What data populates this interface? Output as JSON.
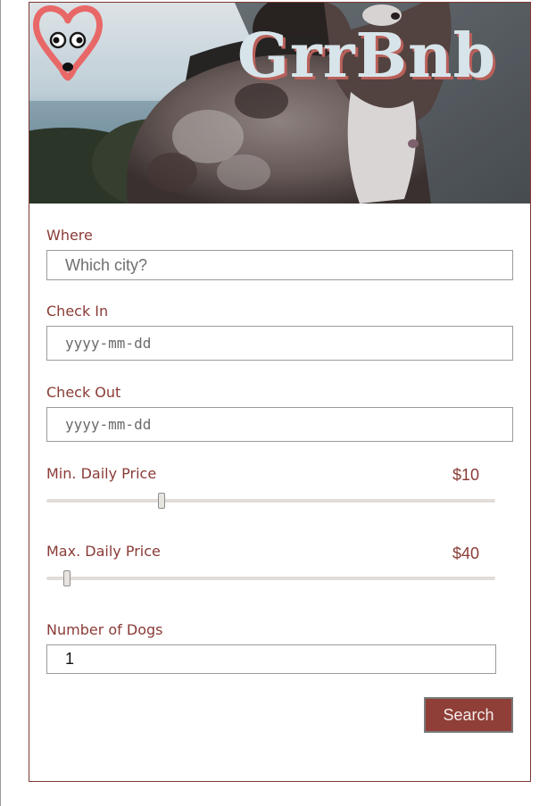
{
  "brand": {
    "name": "GrrBnb",
    "logo_icon": "dog-heart-logo-icon",
    "accent": "#8f3f38",
    "title_color": "#d7e4ea",
    "hero_image": "dog-hero-photo"
  },
  "form": {
    "where": {
      "label": "Where",
      "placeholder": "Which city?",
      "value": ""
    },
    "check_in": {
      "label": "Check In",
      "placeholder": "yyyy-mm-dd",
      "value": ""
    },
    "check_out": {
      "label": "Check Out",
      "placeholder": "yyyy-mm-dd",
      "value": ""
    },
    "min_price": {
      "label": "Min. Daily Price",
      "display": "$10",
      "value": 10
    },
    "max_price": {
      "label": "Max. Daily Price",
      "display": "$40",
      "value": 40
    },
    "dogs": {
      "label": "Number of Dogs",
      "value": "1"
    },
    "search_label": "Search"
  }
}
